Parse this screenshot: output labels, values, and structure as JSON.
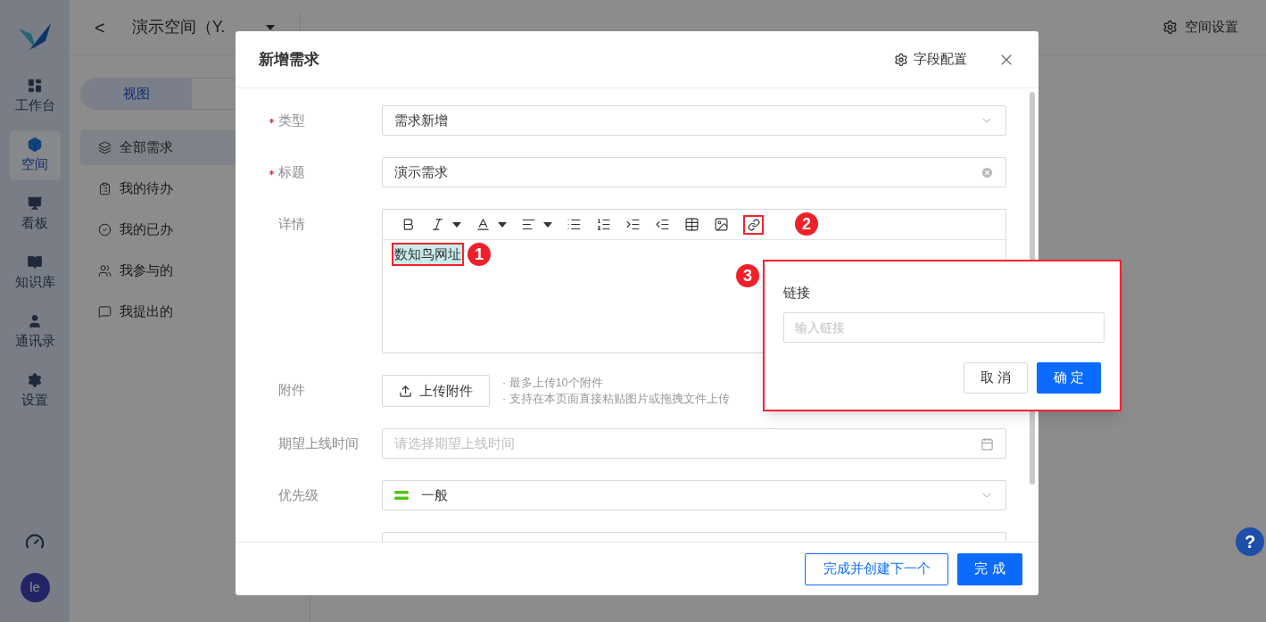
{
  "sidebar": {
    "items": [
      {
        "label": "工作台",
        "selected": false
      },
      {
        "label": "空间",
        "selected": true
      },
      {
        "label": "看板",
        "selected": false
      },
      {
        "label": "知识库",
        "selected": false
      },
      {
        "label": "通讯录",
        "selected": false
      },
      {
        "label": "设置",
        "selected": false
      }
    ],
    "avatar": "le"
  },
  "header": {
    "back": "<",
    "space": "演示空间（Y.",
    "settings": "空间设置"
  },
  "left_panel": {
    "segments": [
      {
        "label": "视图",
        "selected": true
      }
    ],
    "items": [
      {
        "label": "全部需求",
        "selected": true
      },
      {
        "label": "我的待办",
        "selected": false
      },
      {
        "label": "我的已办",
        "selected": false
      },
      {
        "label": "我参与的",
        "selected": false
      },
      {
        "label": "我提出的",
        "selected": false
      }
    ]
  },
  "modal": {
    "title": "新增需求",
    "config": "字段配置",
    "fields": [
      {
        "kind": "select",
        "label": "类型",
        "required": true,
        "value": "需求新增"
      },
      {
        "kind": "text",
        "label": "标题",
        "required": true,
        "value": "演示需求"
      },
      {
        "kind": "editor",
        "label": "详情",
        "required": false,
        "content": "数知鸟网址"
      },
      {
        "kind": "upload",
        "label": "附件",
        "required": false,
        "button": "上传附件",
        "hints": [
          "· 最多上传10个附件",
          "· 支持在本页面直接粘贴图片或拖拽文件上传"
        ]
      },
      {
        "kind": "date",
        "label": "期望上线时间",
        "required": false,
        "placeholder": "请选择期望上线时间"
      },
      {
        "kind": "priority",
        "label": "优先级",
        "required": false,
        "value": "一般",
        "color": "#52c41a"
      }
    ],
    "buttons": [
      {
        "label": "完成并创建下一个",
        "kind": "outline"
      },
      {
        "label": "完 成",
        "kind": "primary"
      }
    ]
  },
  "link_popover": {
    "label": "链接",
    "placeholder": "输入链接",
    "buttons": [
      {
        "label": "取 消",
        "kind": "default"
      },
      {
        "label": "确 定",
        "kind": "primary"
      }
    ]
  },
  "annotations": [
    "1",
    "2",
    "3"
  ],
  "help": "?"
}
